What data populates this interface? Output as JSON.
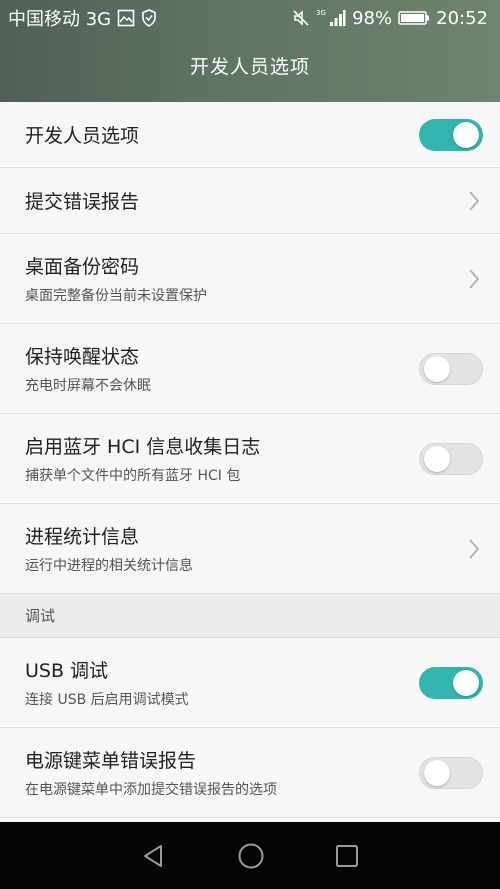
{
  "status_bar": {
    "carrier": "中国移动 3G",
    "battery": "98%",
    "time": "20:52"
  },
  "header": {
    "title": "开发人员选项"
  },
  "rows": [
    {
      "title": "开发人员选项",
      "subtitle": "",
      "control": "toggle",
      "state": "on"
    },
    {
      "title": "提交错误报告",
      "subtitle": "",
      "control": "chevron"
    },
    {
      "title": "桌面备份密码",
      "subtitle": "桌面完整备份当前未设置保护",
      "control": "chevron"
    },
    {
      "title": "保持唤醒状态",
      "subtitle": "充电时屏幕不会休眠",
      "control": "toggle",
      "state": "off"
    },
    {
      "title": "启用蓝牙 HCI 信息收集日志",
      "subtitle": "捕获单个文件中的所有蓝牙 HCI 包",
      "control": "toggle",
      "state": "off"
    },
    {
      "title": "进程统计信息",
      "subtitle": "运行中进程的相关统计信息",
      "control": "chevron"
    }
  ],
  "section": {
    "label": "调试"
  },
  "debug_rows": [
    {
      "title": "USB 调试",
      "subtitle": "连接 USB 后启用调试模式",
      "control": "toggle",
      "state": "on"
    },
    {
      "title": "电源键菜单错误报告",
      "subtitle": "在电源键菜单中添加提交错误报告的选项",
      "control": "toggle",
      "state": "off"
    }
  ],
  "icons": {
    "status_left": [
      "image-icon",
      "shield-icon"
    ],
    "status_right": [
      "mute-icon",
      "signal-icon",
      "battery-icon"
    ],
    "nav": [
      "back-icon",
      "home-icon",
      "recents-icon"
    ]
  },
  "colors": {
    "accent": "#31b5ac",
    "header_start": "#4f5f55",
    "header_end": "#6d8470"
  }
}
